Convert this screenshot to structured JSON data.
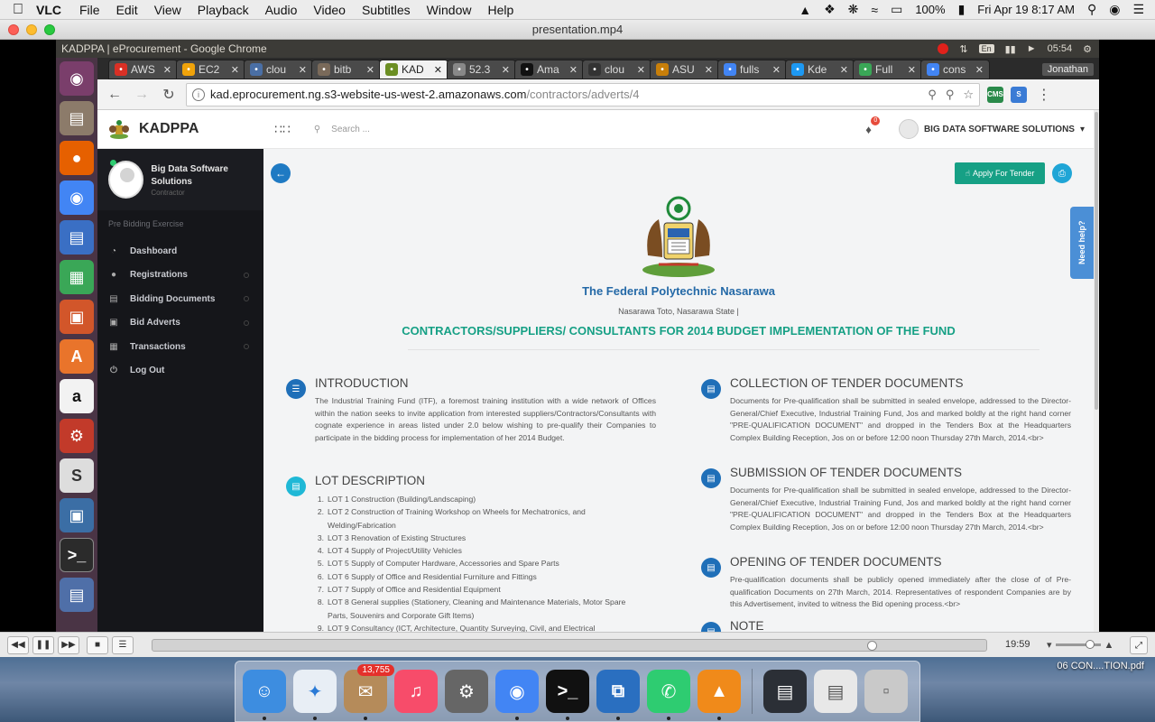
{
  "mac_menubar": {
    "app_name": "VLC",
    "menus": [
      "File",
      "Edit",
      "View",
      "Playback",
      "Audio",
      "Video",
      "Subtitles",
      "Window",
      "Help"
    ],
    "battery": "100%",
    "clock": "Fri Apr 19  8:17 AM"
  },
  "vlc": {
    "window_title": "presentation.mp4",
    "elapsed": "19:59",
    "progress_fraction": 0.868,
    "volume_fraction": 0.82
  },
  "ubuntu": {
    "window_title": "KADPPA | eProcurement - Google Chrome",
    "lang": "En",
    "clock": "05:54"
  },
  "chrome": {
    "profile": "Jonathan",
    "tabs": [
      {
        "label": "AWS",
        "icon": "gmail-icon",
        "color": "#d93025"
      },
      {
        "label": "EC2",
        "icon": "aws-icon",
        "color": "#f0a30a"
      },
      {
        "label": "clou",
        "icon": "shield-icon",
        "color": "#4a6fa5"
      },
      {
        "label": "bitb",
        "icon": "user-icon",
        "color": "#7a6a5a"
      },
      {
        "label": "KAD",
        "icon": "crest-icon",
        "color": "#6b8e23"
      },
      {
        "label": "52.3",
        "icon": "page-icon",
        "color": "#888888"
      },
      {
        "label": "Ama",
        "icon": "amazon-icon",
        "color": "#111111"
      },
      {
        "label": "clou",
        "icon": "hash-icon",
        "color": "#333333"
      },
      {
        "label": "ASU",
        "icon": "cart-icon",
        "color": "#c87f0a"
      },
      {
        "label": "fulls",
        "icon": "google-icon",
        "color": "#4285f4"
      },
      {
        "label": "Kde",
        "icon": "k-icon",
        "color": "#1d99f3"
      },
      {
        "label": "Full",
        "icon": "sheet-icon",
        "color": "#3aa757"
      },
      {
        "label": "cons",
        "icon": "google-icon",
        "color": "#4285f4"
      }
    ],
    "active_tab": 4,
    "url_host": "kad.eprocurement.ng.s3-website-us-west-2.amazonaws.com",
    "url_path": "/contractors/adverts/4"
  },
  "app": {
    "brand": "KADPPA",
    "search_placeholder": "Search ...",
    "notifications": "0",
    "user_name": "BIG DATA SOFTWARE SOLUTIONS"
  },
  "sidebar": {
    "profile_name": "Big Data Software Solutions",
    "profile_role": "Contractor",
    "section": "Pre Bidding Exercise",
    "items": [
      {
        "label": "Dashboard",
        "icon": "dashboard-icon"
      },
      {
        "label": "Registrations",
        "icon": "registrations-icon"
      },
      {
        "label": "Bidding Documents",
        "icon": "documents-icon"
      },
      {
        "label": "Bid Adverts",
        "icon": "adverts-icon"
      },
      {
        "label": "Transactions",
        "icon": "transactions-icon"
      },
      {
        "label": "Log Out",
        "icon": "power-icon"
      }
    ]
  },
  "advert": {
    "apply_label": "Apply For Tender",
    "need_help": "Need help?",
    "org_name": "The Federal Polytechnic Nasarawa",
    "org_address": "Nasarawa Toto, Nasarawa State |",
    "title": "CONTRACTORS/SUPPLIERS/ CONSULTANTS FOR 2014 BUDGET IMPLEMENTATION OF THE FUND",
    "introduction": {
      "heading": "INTRODUCTION",
      "body": "The Industrial Training Fund (ITF), a foremost training institution with a wide network of Offices within the nation seeks to invite application from interested suppliers/Contractors/Consultants with cognate experience in areas listed under 2.0 below wishing to pre-qualify their Companies to participate in the bidding process for implementation of her 2014 Budget."
    },
    "lot_description": {
      "heading": "LOT DESCRIPTION",
      "items": [
        "LOT 1 Construction (Building/Landscaping)",
        "LOT 2 Construction of Training Workshop on Wheels for Mechatronics, and Welding/Fabrication",
        "LOT 3 Renovation of Existing Structures",
        "LOT 4 Supply of Project/Utility Vehicles",
        "LOT 5 Supply of Computer Hardware, Accessories and Spare Parts",
        "LOT 6 Supply of Office and Residential Furniture and Fittings",
        "LOT 7 Supply of Office and Residential Equipment",
        "LOT 8 General supplies (Stationery, Cleaning and Maintenance Materials, Motor Spare Parts, Souvenirs and Corporate Gift Items)",
        "LOT 9 Consultancy (ICT, Architecture, Quantity Surveying, Civil, and Electrical"
      ]
    },
    "collection": {
      "heading": "COLLECTION OF TENDER DOCUMENTS",
      "body": "Documents for Pre-qualification shall be submitted in sealed envelope, addressed to the Director-General/Chief Executive, Industrial Training Fund, Jos and marked boldly at the right hand corner \"PRE-QUALIFICATION DOCUMENT\" and dropped in the Tenders Box at the Headquarters Complex Building Reception, Jos on or before 12:00 noon Thursday 27th March, 2014.<br>"
    },
    "submission": {
      "heading": "SUBMISSION OF TENDER DOCUMENTS",
      "body": "Documents for Pre-qualification shall be submitted in sealed envelope, addressed to the Director-General/Chief Executive, Industrial Training Fund, Jos and marked boldly at the right hand corner \"PRE-QUALIFICATION DOCUMENT\" and dropped in the Tenders Box at the Headquarters Complex Building Reception, Jos on or before 12:00 noon Thursday 27th March, 2014.<br>"
    },
    "opening": {
      "heading": "OPENING OF TENDER DOCUMENTS",
      "body": "Pre-qualification documents shall be publicly opened immediately after the close of of Pre-qualification Documents on 27th March, 2014. Representatives of respondent Companies are by this Advertisement, invited to witness the Bid opening process.<br>"
    },
    "note": {
      "heading": "NOTE"
    }
  },
  "desktop": {
    "file_label": "06 CON....TION.pdf",
    "mail_badge": "13,755"
  }
}
